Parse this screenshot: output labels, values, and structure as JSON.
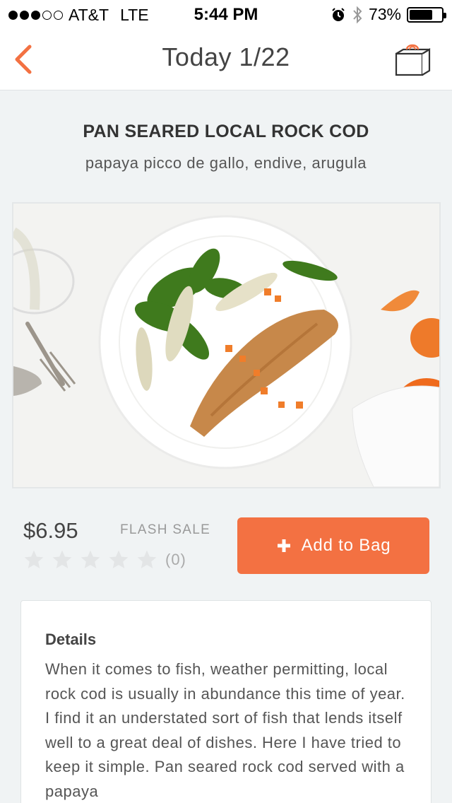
{
  "status_bar": {
    "carrier": "AT&T",
    "network": "LTE",
    "time": "5:44 PM",
    "battery_percent_label": "73%",
    "battery_level": 0.73,
    "signal_bars_filled": 3,
    "signal_bars_total": 5
  },
  "nav": {
    "title": "Today 1/22",
    "back_icon": "chevron-left-icon",
    "bag_icon": "shopping-bag-icon",
    "accent_color": "#f37142"
  },
  "dish": {
    "name": "PAN SEARED LOCAL ROCK COD",
    "subtitle": "papaya picco de gallo, endive, arugula"
  },
  "purchase": {
    "price": "$6.95",
    "badge": "FLASH SALE",
    "rating_count": "(0)",
    "rating_value": 0,
    "rating_max": 5,
    "add_button_label": "Add to Bag",
    "button_color": "#f37142"
  },
  "details": {
    "title": "Details",
    "body": "When it comes to fish, weather permitting, local rock cod is usually in abundance this time of year. I find it an understated sort of fish that lends itself well to a great deal of dishes. Here I have tried to keep it simple. Pan seared rock cod served with a papaya"
  }
}
